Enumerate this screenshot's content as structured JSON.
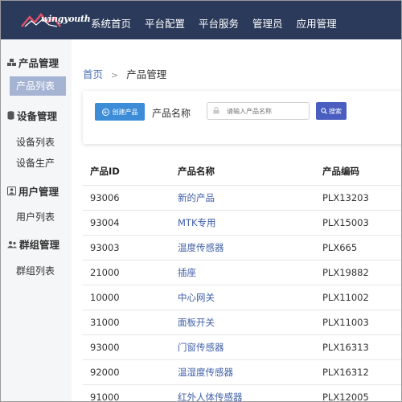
{
  "brand": {
    "name": "wingyouth"
  },
  "nav": {
    "items": [
      "系统首页",
      "平台配置",
      "平台服务",
      "管理员",
      "应用管理"
    ]
  },
  "sidebar": {
    "groups": [
      {
        "title": "产品管理",
        "icon": "cubes-icon",
        "items": [
          "产品列表"
        ]
      },
      {
        "title": "设备管理",
        "icon": "database-icon",
        "items": [
          "设备列表",
          "设备生产"
        ]
      },
      {
        "title": "用户管理",
        "icon": "user-card-icon",
        "items": [
          "用户列表"
        ]
      },
      {
        "title": "群组管理",
        "icon": "users-icon",
        "items": [
          "群组列表"
        ]
      }
    ],
    "active_item": "产品列表"
  },
  "breadcrumb": {
    "home": "首页",
    "separator": ">",
    "current": "产品管理"
  },
  "search": {
    "create_label": "创建产品",
    "field_label": "产品名称",
    "placeholder": "请输入产品名称",
    "search_label": "搜索"
  },
  "table": {
    "columns": [
      "产品ID",
      "产品名称",
      "产品编码"
    ],
    "rows": [
      [
        "93006",
        "新的产品",
        "PLX13203"
      ],
      [
        "93004",
        "MTK专用",
        "PLX15003"
      ],
      [
        "93003",
        "温度传感器",
        "PLX665"
      ],
      [
        "21000",
        "插座",
        "PLX19882"
      ],
      [
        "10000",
        "中心网关",
        "PLX11002"
      ],
      [
        "31000",
        "面板开关",
        "PLX11003"
      ],
      [
        "93000",
        "门窗传感器",
        "PLX16313"
      ],
      [
        "92000",
        "温湿度传感器",
        "PLX16312"
      ],
      [
        "91000",
        "红外人体传感器",
        "PLX12005"
      ]
    ]
  },
  "colors": {
    "topbar": "#2b3a5a",
    "active": "#a6b4d4",
    "create": "#3c8cd8",
    "search": "#4a5ec0",
    "link": "#3f5fa8"
  }
}
